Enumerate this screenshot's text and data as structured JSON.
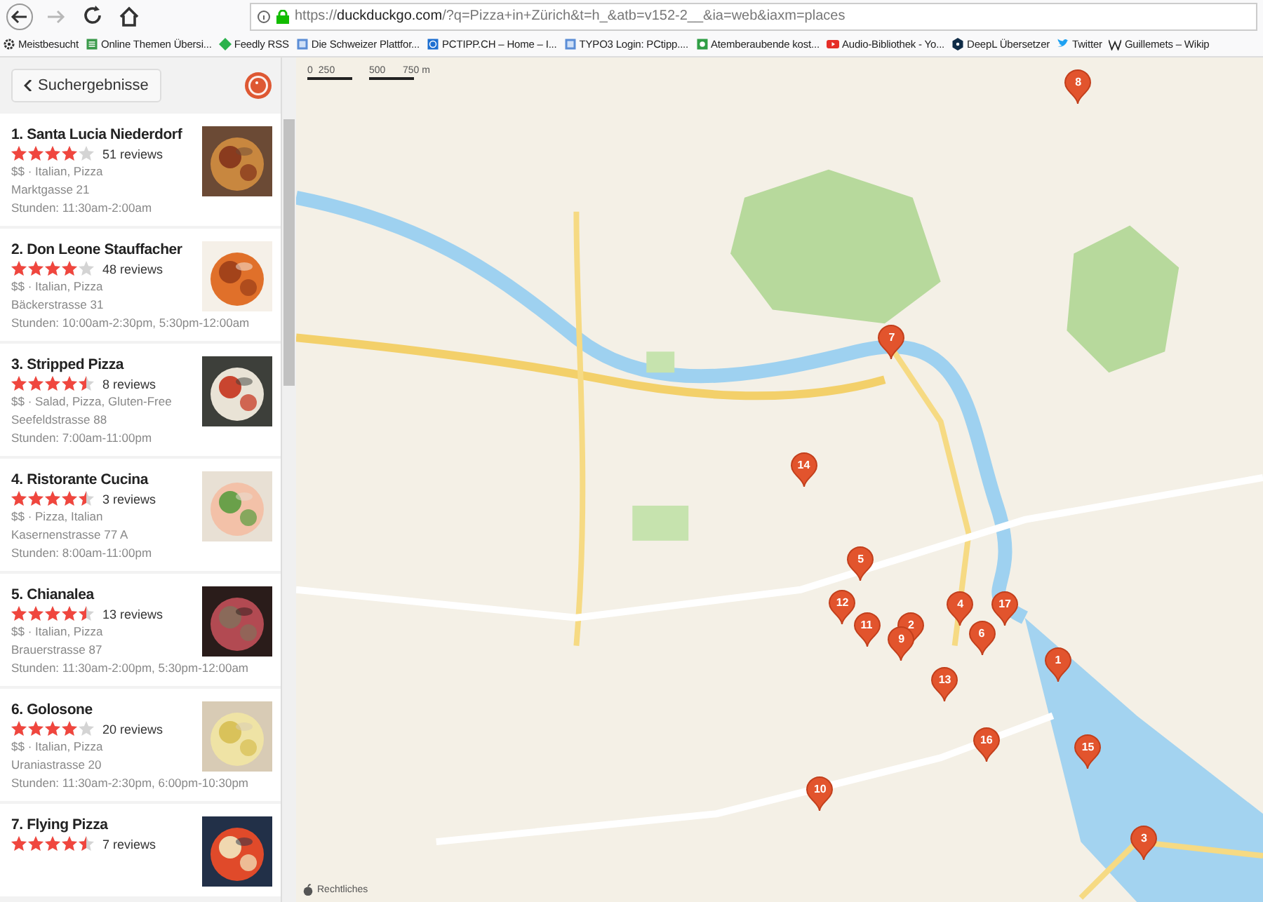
{
  "browser": {
    "nav": [
      {
        "kind": "back",
        "disabled": false
      },
      {
        "kind": "forward",
        "disabled": true
      },
      {
        "kind": "reload",
        "disabled": false
      },
      {
        "kind": "home",
        "disabled": false
      }
    ],
    "url": "https://**duckduckgo.com**/?q=Pizza+in+Zürich&t=h_&atb=v152-2__&ia=web&iaxm=places",
    "bookmarks": [
      {
        "kind": "gear",
        "label": "Meistbesucht"
      },
      {
        "kind": "sheet",
        "label": "Online Themen Übersi..."
      },
      {
        "kind": "diamond",
        "label": "Feedly RSS"
      },
      {
        "kind": "page",
        "label": "Die Schweizer Plattfor..."
      },
      {
        "kind": "square",
        "label": "PCTIPP.CH – Home – I..."
      },
      {
        "kind": "page",
        "label": "TYPO3 Login: PCtipp...."
      },
      {
        "kind": "game",
        "label": "Atemberaubende kost..."
      },
      {
        "kind": "video",
        "label": "Audio-Bibliothek - Yo..."
      },
      {
        "kind": "deepl",
        "label": "DeepL Übersetzer"
      },
      {
        "kind": "bird",
        "label": "Twitter"
      },
      {
        "kind": "wiki",
        "label": "Guillemets – Wikip"
      }
    ]
  },
  "sidebar": {
    "back_button": "Suchergebnisse",
    "results": [
      {
        "title": "1. Santa Lucia Niederdorf",
        "stars": 4,
        "reviews": "51 reviews",
        "category": "$$ · Italian, Pizza",
        "address": "Marktgasse 21",
        "hours": "Stunden: 11:30am-2:00am"
      },
      {
        "title": "2. Don Leone Stauffacher",
        "stars": 4,
        "reviews": "48 reviews",
        "category": "$$ · Italian, Pizza",
        "address": "Bäckerstrasse 31",
        "hours": "Stunden: 10:00am-2:30pm, 5:30pm-12:00am"
      },
      {
        "title": "3. Stripped Pizza",
        "stars": 4.5,
        "reviews": "8 reviews",
        "category": "$$ · Salad, Pizza, Gluten-Free",
        "address": "Seefeldstrasse 88",
        "hours": "Stunden: 7:00am-11:00pm"
      },
      {
        "title": "4. Ristorante Cucina",
        "stars": 4.5,
        "reviews": "3 reviews",
        "category": "$$ · Pizza, Italian",
        "address": "Kasernenstrasse 77 A",
        "hours": "Stunden: 8:00am-11:00pm"
      },
      {
        "title": "5. Chianalea",
        "stars": 4.5,
        "reviews": "13 reviews",
        "category": "$$ · Italian, Pizza",
        "address": "Brauerstrasse 87",
        "hours": "Stunden: 11:30am-2:00pm, 5:30pm-12:00am"
      },
      {
        "title": "6. Golosone",
        "stars": 4,
        "reviews": "20 reviews",
        "category": "$$ · Italian, Pizza",
        "address": "Uraniastrasse 20",
        "hours": "Stunden: 11:30am-2:30pm, 6:00pm-10:30pm"
      },
      {
        "title": "7. Flying Pizza",
        "stars": 4.5,
        "reviews": "7 reviews"
      }
    ]
  },
  "map": {
    "kind": "picture",
    "scale": [
      "0",
      "250",
      "500",
      "750 m"
    ],
    "legal": "Rechtliches",
    "pins": [
      "8",
      "7",
      "14",
      "5",
      "12",
      "11",
      "2",
      "9",
      "4",
      "17",
      "6",
      "1",
      "13",
      "16",
      "15",
      "10",
      "3"
    ]
  }
}
